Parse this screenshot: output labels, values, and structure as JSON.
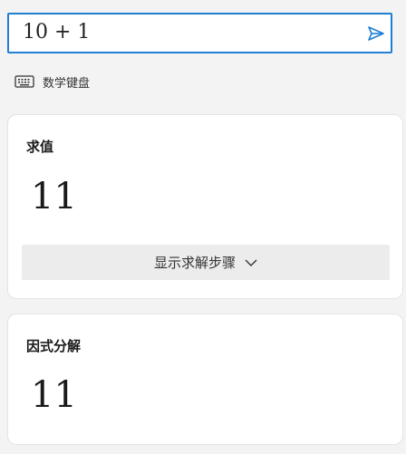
{
  "input": {
    "expression": "10 + 1"
  },
  "keyboard": {
    "label": "数学键盘",
    "icon": "keyboard-icon"
  },
  "send": {
    "icon": "send-icon",
    "color": "#1f7fd2"
  },
  "evaluate_card": {
    "title": "求值",
    "result": "11",
    "steps_button_label": "显示求解步骤"
  },
  "factor_card": {
    "title": "因式分解",
    "result": "11"
  },
  "colors": {
    "accent": "#1f7fd2",
    "background": "#f3f3f3",
    "card": "#ffffff"
  }
}
